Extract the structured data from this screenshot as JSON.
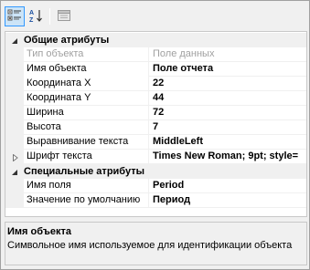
{
  "toolbar": {
    "categorized_icon": "categorized-icon",
    "alphabetical_icon": "alphabetical-icon",
    "property_pages_icon": "property-pages-icon"
  },
  "categories": [
    {
      "label": "Общие атрибуты",
      "rows": [
        {
          "name": "Тип объекта",
          "value": "Поле данных",
          "disabled": true
        },
        {
          "name": "Имя объекта",
          "value": "Поле отчета"
        },
        {
          "name": "Координата X",
          "value": "22"
        },
        {
          "name": "Координата Y",
          "value": "44"
        },
        {
          "name": "Ширина",
          "value": "72"
        },
        {
          "name": "Высота",
          "value": "7"
        },
        {
          "name": "Выравнивание текста",
          "value": "MiddleLeft"
        },
        {
          "name": "Шрифт текста",
          "value": "Times New Roman; 9pt; style=",
          "expandable": true
        }
      ]
    },
    {
      "label": "Специальные атрибуты",
      "rows": [
        {
          "name": "Имя поля",
          "value": "Period"
        },
        {
          "name": "Значение по умолчанию",
          "value": "Период"
        }
      ]
    }
  ],
  "help": {
    "title": "Имя объекта",
    "description": "Символьное имя используемое для идентификации объекта"
  },
  "colors": {
    "accent": "#3399ff",
    "category_bg": "#f0f0f0",
    "disabled_text": "#a0a0a0"
  }
}
